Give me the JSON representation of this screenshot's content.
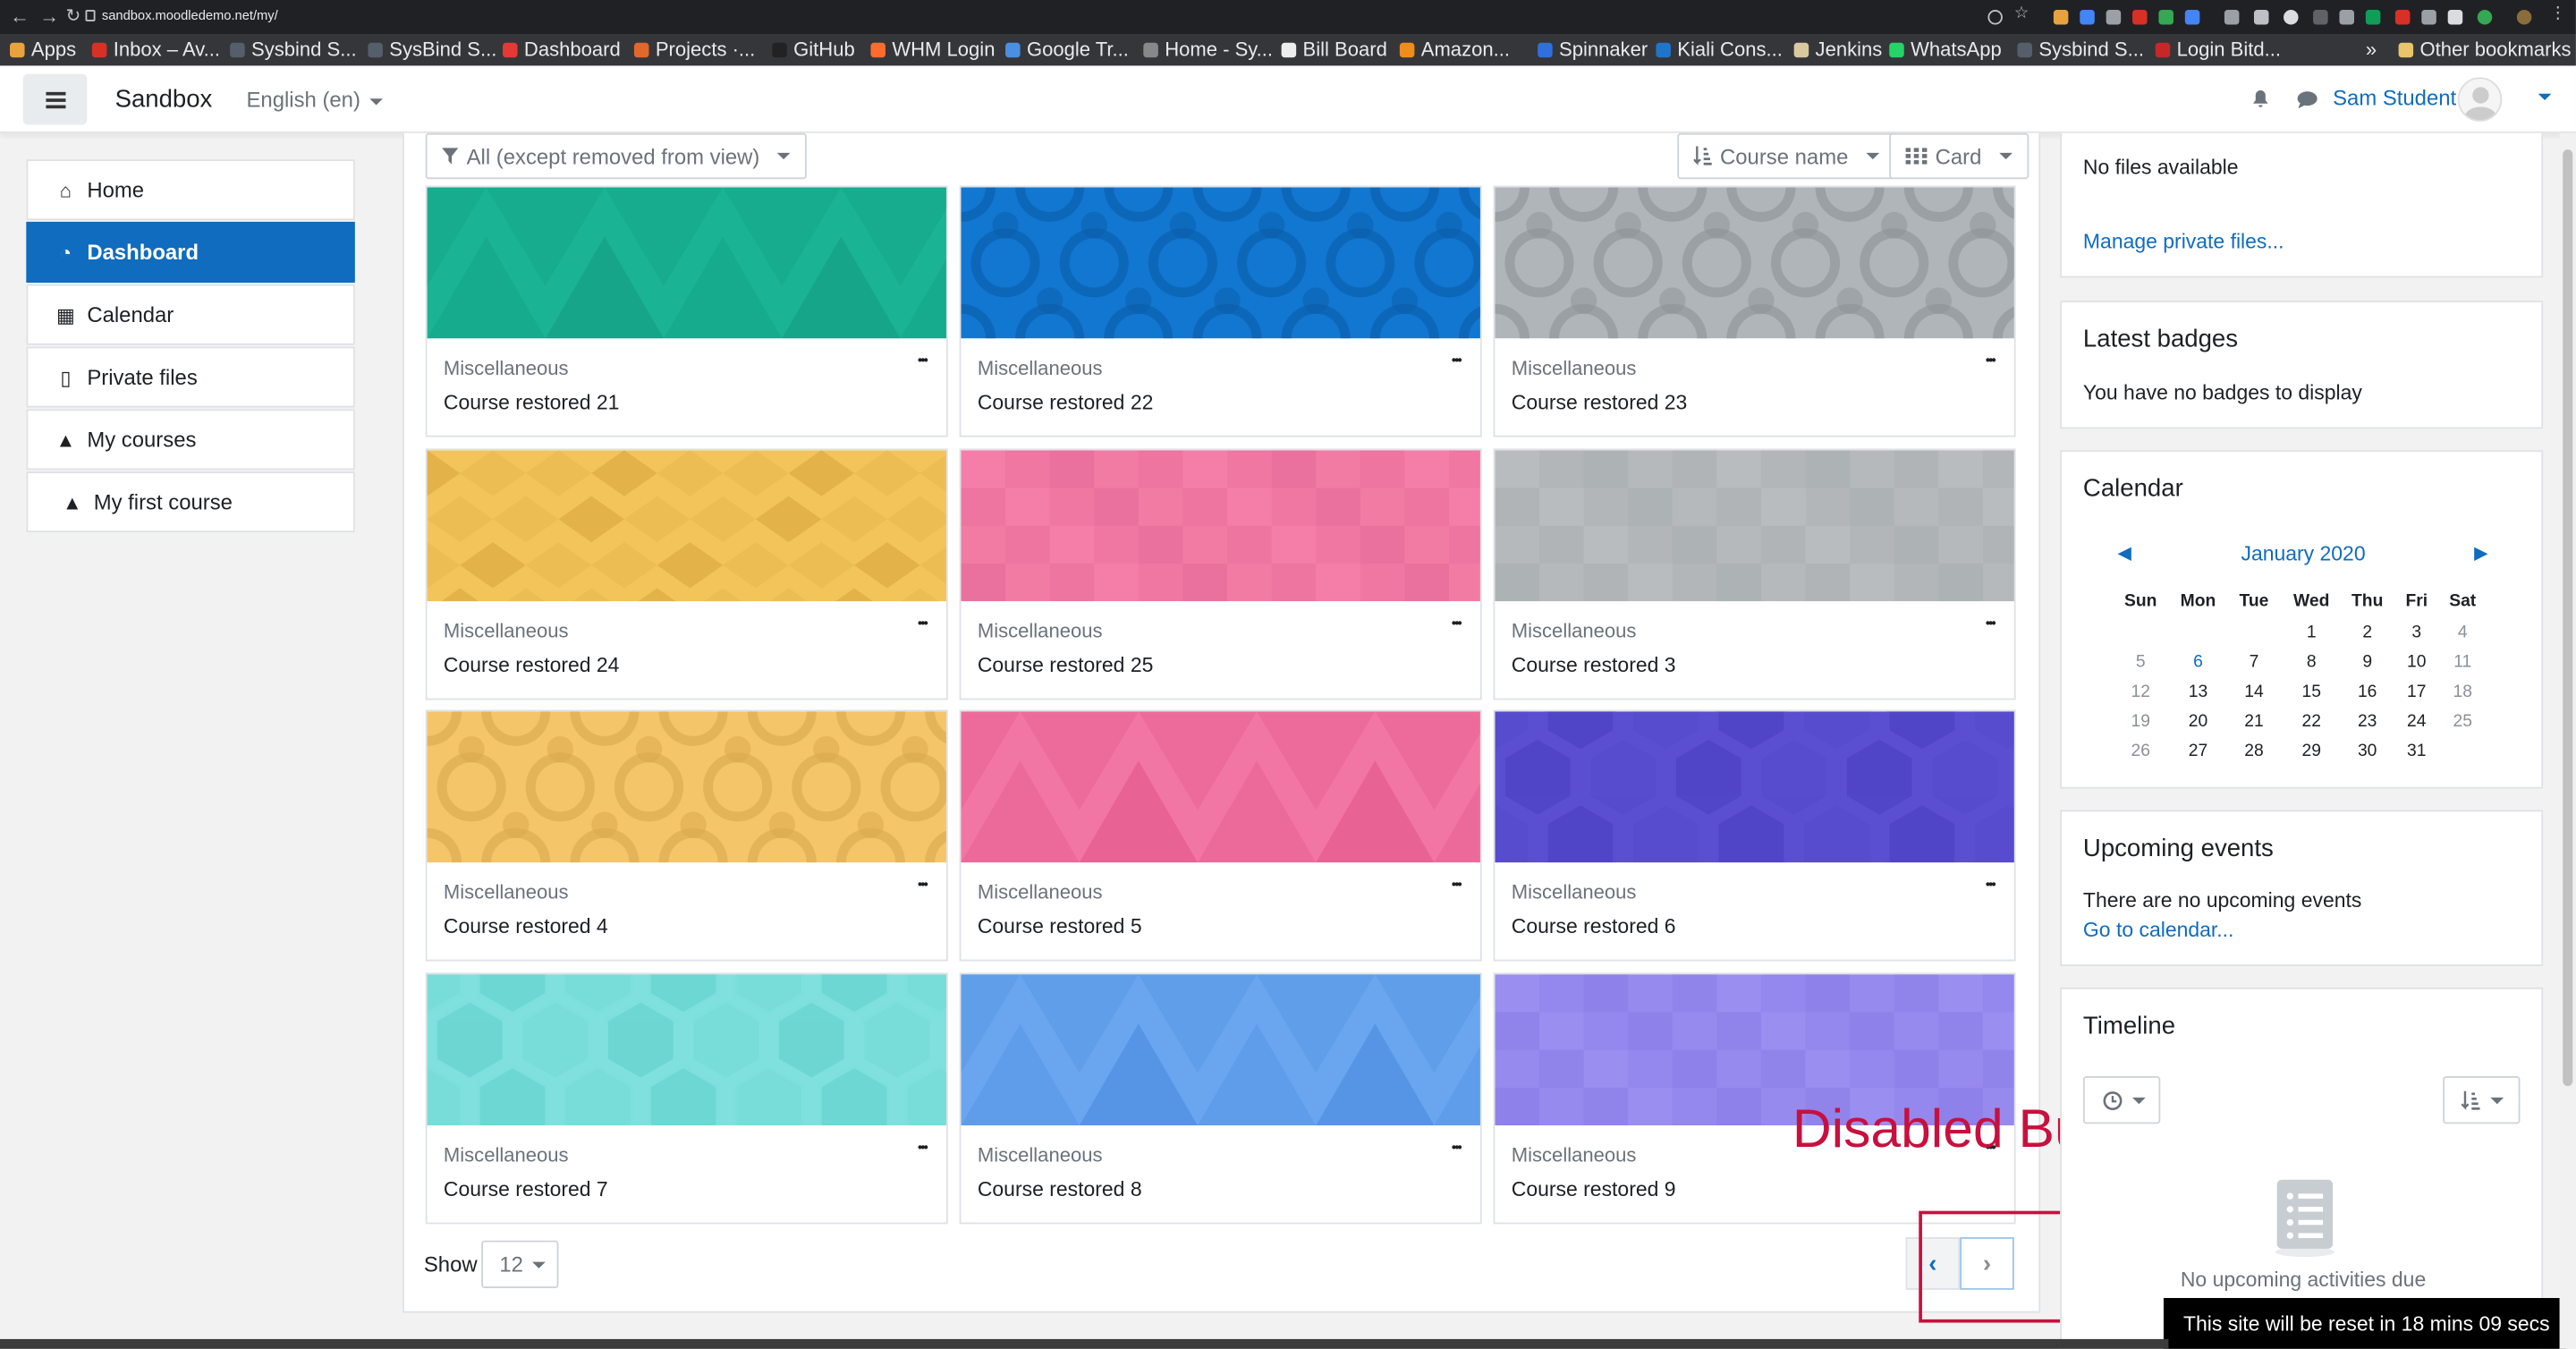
{
  "browser": {
    "url": "sandbox.moodledemo.net/my/",
    "bookmarks": [
      {
        "label": "Apps",
        "color": "#e8a33d"
      },
      {
        "label": "Inbox – Av...",
        "color": "#d93025"
      },
      {
        "label": "Sysbind S...",
        "color": "#555f6b"
      },
      {
        "label": "SysBind S...",
        "color": "#555f6b"
      },
      {
        "label": "Dashboard",
        "color": "#e53935"
      },
      {
        "label": "Projects ·...",
        "color": "#e2672a"
      },
      {
        "label": "GitHub",
        "color": "#222222"
      },
      {
        "label": "WHM Login",
        "color": "#ff6c2c"
      },
      {
        "label": "Google Tr...",
        "color": "#4a90e2"
      },
      {
        "label": "Home - Sy...",
        "color": "#888888"
      },
      {
        "label": "Bill Board",
        "color": "#eeeeee"
      },
      {
        "label": "Amazon...",
        "color": "#f08c1a"
      },
      {
        "label": "Spinnaker",
        "color": "#2f6fde"
      },
      {
        "label": "Kiali Cons...",
        "color": "#1f75cb"
      },
      {
        "label": "Jenkins",
        "color": "#d9c8a0"
      },
      {
        "label": "WhatsApp",
        "color": "#25d366"
      },
      {
        "label": "Sysbind S...",
        "color": "#555f6b"
      },
      {
        "label": "Login Bitd...",
        "color": "#c62828"
      }
    ],
    "other_bookmarks": "Other bookmarks",
    "overflow": "»"
  },
  "navbar": {
    "brand": "Sandbox",
    "language": "English (en)",
    "user_name": "Sam Student"
  },
  "leftnav": [
    {
      "label": "Home",
      "icon": "home-icon",
      "selected": false
    },
    {
      "label": "Dashboard",
      "icon": "dashboard-icon",
      "selected": true
    },
    {
      "label": "Calendar",
      "icon": "calendar-icon",
      "selected": false
    },
    {
      "label": "Private files",
      "icon": "file-icon",
      "selected": false
    },
    {
      "label": "My courses",
      "icon": "graduation-cap-icon",
      "selected": false
    },
    {
      "label": "My first course",
      "icon": "graduation-cap-icon",
      "selected": false
    }
  ],
  "courses_toolbar": {
    "filter": "All (except removed from view)",
    "sort": "Course name",
    "view": "Card"
  },
  "courses": [
    {
      "category": "Miscellaneous",
      "name": "Course restored 21",
      "pattern": "triangles",
      "color": "#1ab394",
      "accent": "#15a085"
    },
    {
      "category": "Miscellaneous",
      "name": "Course restored 22",
      "pattern": "circles",
      "color": "#1177d1",
      "accent": "#0b5ea8"
    },
    {
      "category": "Miscellaneous",
      "name": "Course restored 23",
      "pattern": "circles",
      "color": "#b0b5b9",
      "accent": "#8e9397"
    },
    {
      "category": "Miscellaneous",
      "name": "Course restored 24",
      "pattern": "diamonds",
      "color": "#f2c45a",
      "accent": "#d9a63e"
    },
    {
      "category": "Miscellaneous",
      "name": "Course restored 25",
      "pattern": "squares",
      "color": "#f57ea8",
      "accent": "#d9608c"
    },
    {
      "category": "Miscellaneous",
      "name": "Course restored 3",
      "pattern": "squares",
      "color": "#b8bcbf",
      "accent": "#9ea2a5"
    },
    {
      "category": "Miscellaneous",
      "name": "Course restored 4",
      "pattern": "circles",
      "color": "#f5c56a",
      "accent": "#d9a84c"
    },
    {
      "category": "Miscellaneous",
      "name": "Course restored 5",
      "pattern": "triangles",
      "color": "#f276a4",
      "accent": "#e45a8d"
    },
    {
      "category": "Miscellaneous",
      "name": "Course restored 6",
      "pattern": "hexagons",
      "color": "#5b4fd1",
      "accent": "#4a3fc0"
    },
    {
      "category": "Miscellaneous",
      "name": "Course restored 7",
      "pattern": "hexagons",
      "color": "#7fe0dd",
      "accent": "#5fcfcb"
    },
    {
      "category": "Miscellaneous",
      "name": "Course restored 8",
      "pattern": "triangles",
      "color": "#6aa6f0",
      "accent": "#4f8fe0"
    },
    {
      "category": "Miscellaneous",
      "name": "Course restored 9",
      "pattern": "squares",
      "color": "#9a8ef0",
      "accent": "#7c6ee0"
    }
  ],
  "pagination": {
    "show_label": "Show",
    "per_page": "12",
    "prev": "‹",
    "next": "›"
  },
  "annotation": {
    "label": "Disabled Button",
    "color": "#c8103e"
  },
  "private_files": {
    "empty": "No files available",
    "manage_link": "Manage private files..."
  },
  "badges": {
    "title": "Latest badges",
    "empty": "You have no badges to display"
  },
  "calendar": {
    "title": "Calendar",
    "month": "January 2020",
    "prev": "◀",
    "next": "▶",
    "day_headers": [
      "Sun",
      "Mon",
      "Tue",
      "Wed",
      "Thu",
      "Fri",
      "Sat"
    ],
    "weeks": [
      [
        "",
        "",
        "",
        "1",
        "2",
        "3",
        "4"
      ],
      [
        "5",
        "6",
        "7",
        "8",
        "9",
        "10",
        "11"
      ],
      [
        "12",
        "13",
        "14",
        "15",
        "16",
        "17",
        "18"
      ],
      [
        "19",
        "20",
        "21",
        "22",
        "23",
        "24",
        "25"
      ],
      [
        "26",
        "27",
        "28",
        "29",
        "30",
        "31",
        ""
      ]
    ],
    "highlight_day": "6"
  },
  "upcoming": {
    "title": "Upcoming events",
    "empty": "There are no upcoming events",
    "link": "Go to calendar..."
  },
  "timeline": {
    "title": "Timeline",
    "empty": "No upcoming activities due"
  },
  "reset_notice": "This site will be reset in 18 mins 09 secs"
}
